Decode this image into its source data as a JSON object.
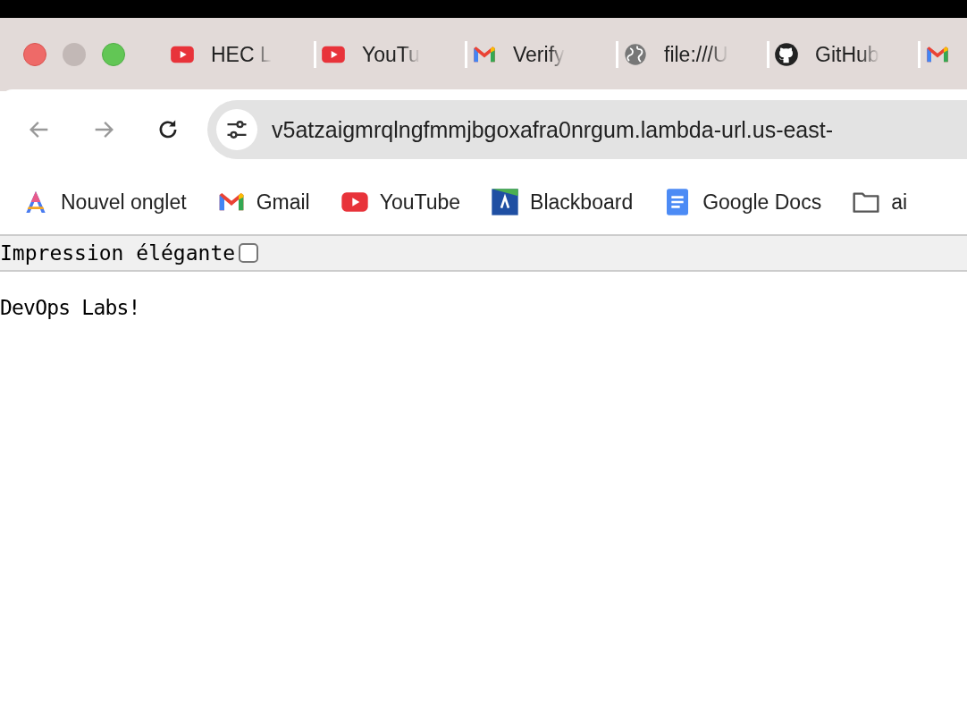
{
  "tabs": [
    {
      "kind": "youtube",
      "title": "HEC L"
    },
    {
      "kind": "youtube",
      "title": "YouTu"
    },
    {
      "kind": "gmail",
      "title": "Verify"
    },
    {
      "kind": "globe",
      "title": "file:///U"
    },
    {
      "kind": "github",
      "title": "GitHub"
    },
    {
      "kind": "gmail"
    }
  ],
  "toolbar": {
    "url": "v5atzaigmrqlngfmmjbgoxafra0nrgum.lambda-url.us-east-"
  },
  "bookmarks": [
    {
      "kind": "app",
      "label": "Nouvel onglet"
    },
    {
      "kind": "gmail",
      "label": "Gmail"
    },
    {
      "kind": "youtube",
      "label": "YouTube"
    },
    {
      "kind": "blackboard",
      "label": "Blackboard"
    },
    {
      "kind": "docs",
      "label": "Google Docs"
    },
    {
      "kind": "folder",
      "label": "ai"
    }
  ],
  "page": {
    "pretty_print": {
      "label": "Impression élégante",
      "checked": false
    },
    "body": "DevOps Labs!"
  }
}
